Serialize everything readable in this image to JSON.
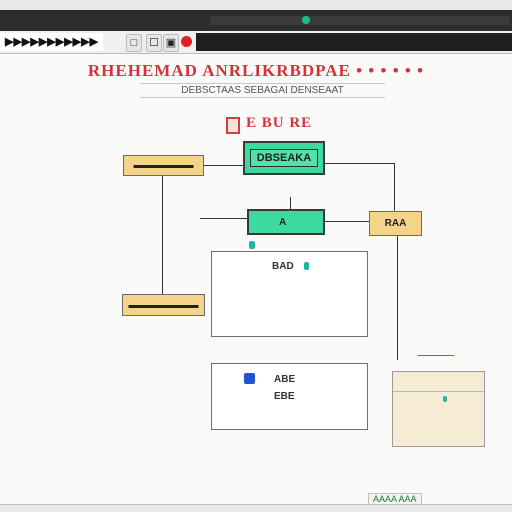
{
  "window": {
    "toolbar_title": "▶▶▶▶▶▶▶▶▶▶▶",
    "buttons": [
      "□",
      "☐",
      "▣"
    ]
  },
  "document": {
    "title": "RHEHEMAD ANRLIKRBDPAE • • • • • •",
    "subtitle": "DEBSCTAAS  SEBAGAI DENSEAAT",
    "section_label": "E BU RE"
  },
  "diagram": {
    "top_left_box": "▬▬▬▬▬▬",
    "top_green_box": "DBSEAKA",
    "middle_green_box": "A",
    "right_box": "RAA",
    "left_lower_box": "▬▬▬▬▬▬▬",
    "panel_one_text": "BAD",
    "panel_two_line1": "ABE",
    "panel_two_line2": "EBE"
  },
  "status": {
    "text": "AAAA AAA"
  },
  "colors": {
    "accent_red": "#d0333a",
    "node_green": "#3ddaa0",
    "node_orange": "#f5d48a",
    "status_green": "#17c37b",
    "record_red": "#e02020",
    "marker_blue": "#2255cc",
    "marker_teal": "#1fb5a0"
  }
}
